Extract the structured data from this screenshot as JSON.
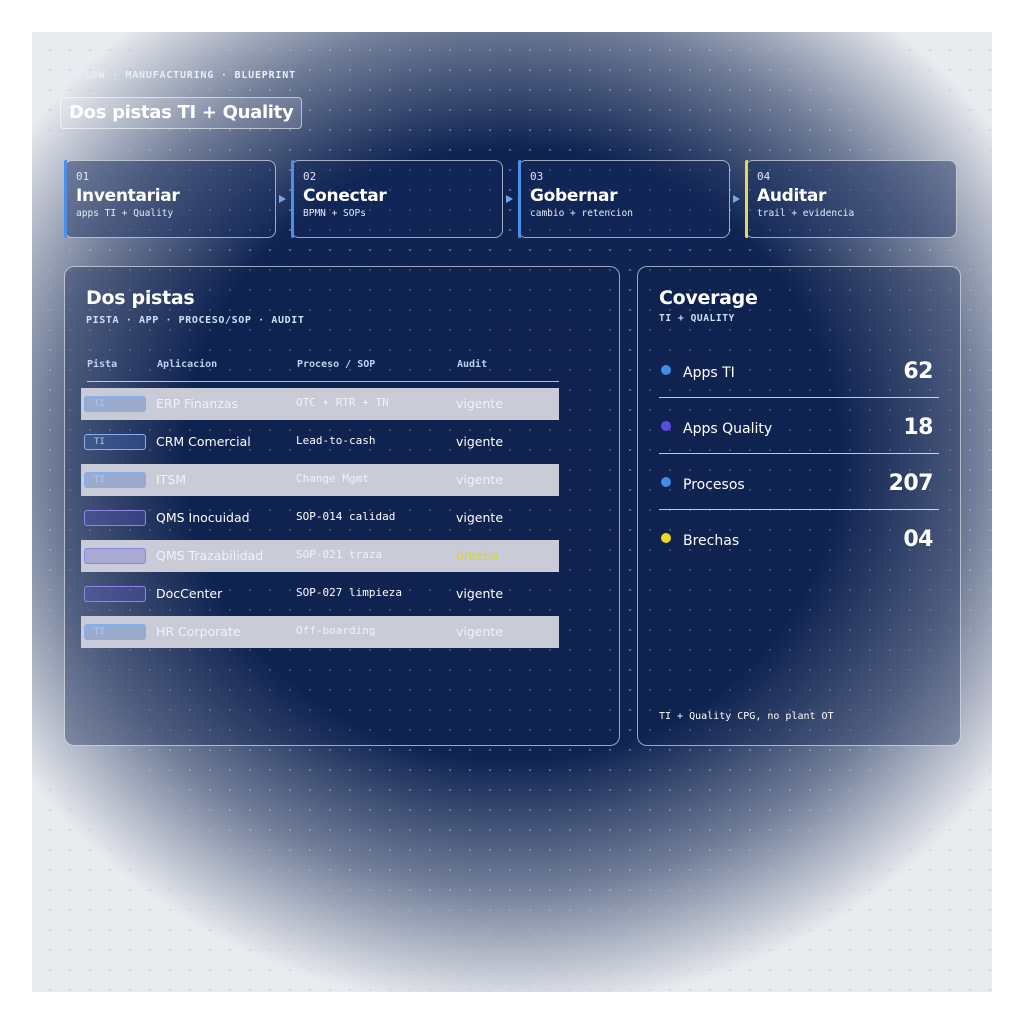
{
  "header": {
    "eyebrow": "EAFLOW · MANUFACTURING · BLUEPRINT",
    "title": "Dos pistas TI + Quality"
  },
  "steps": [
    {
      "num": "01",
      "name": "Inventariar",
      "sub": "apps TI + Quality",
      "color": "#4a8fe8"
    },
    {
      "num": "02",
      "name": "Conectar",
      "sub": "BPMN + SOPs",
      "color": "#4a8fe8"
    },
    {
      "num": "03",
      "name": "Gobernar",
      "sub": "cambio + retencion",
      "color": "#4a8fe8"
    },
    {
      "num": "04",
      "name": "Auditar",
      "sub": "trail + evidencia",
      "color": "#e8d84a"
    }
  ],
  "tracks": {
    "title": "Dos pistas",
    "caption": "PISTA · APP · PROCESO/SOP · AUDIT",
    "columns": [
      "Pista",
      "Aplicacion",
      "Proceso / SOP",
      "Audit"
    ],
    "rows": [
      {
        "pista": "TI",
        "app": "ERP Finanzas",
        "proceso": "OTC + RTR + TN",
        "audit": "vigente"
      },
      {
        "pista": "TI",
        "app": "CRM Comercial",
        "proceso": "Lead-to-cash",
        "audit": "vigente"
      },
      {
        "pista": "TI",
        "app": "ITSM",
        "proceso": "Change Mgmt",
        "audit": "vigente"
      },
      {
        "pista": "",
        "app": "QMS Inocuidad",
        "proceso": "SOP-014 calidad",
        "audit": "vigente"
      },
      {
        "pista": "",
        "app": "QMS Trazabilidad",
        "proceso": "SOP-021 traza",
        "audit": "brecha"
      },
      {
        "pista": "",
        "app": "DocCenter",
        "proceso": "SOP-027 limpieza",
        "audit": "vigente"
      },
      {
        "pista": "TI",
        "app": "HR Corporate",
        "proceso": "Off-boarding",
        "audit": "vigente"
      }
    ]
  },
  "coverage": {
    "title": "Coverage",
    "caption": "TI + QUALITY",
    "metrics": [
      {
        "label": "Apps TI",
        "value": "62",
        "color": "#3d8fe6"
      },
      {
        "label": "Apps Quality",
        "value": "18",
        "color": "#5b4be0"
      },
      {
        "label": "Procesos",
        "value": "207",
        "color": "#3d8fe6"
      },
      {
        "label": "Brechas",
        "value": "04",
        "color": "#e8dc1e"
      }
    ],
    "footnote": "TI + Quality CPG, no plant OT"
  }
}
